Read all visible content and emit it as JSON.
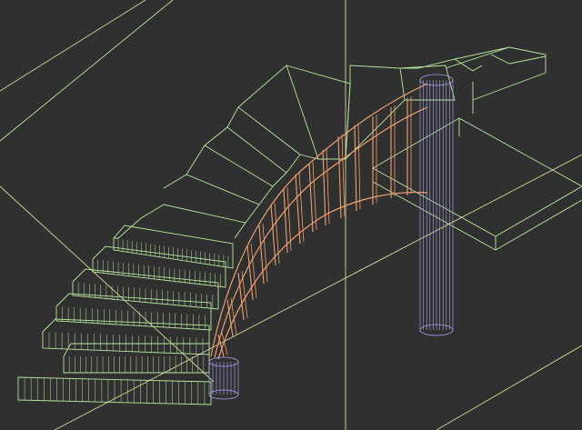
{
  "viewport": {
    "view": "3d-perspective-wireframe",
    "background": "#303030"
  },
  "scene": {
    "objects": [
      {
        "name": "curved-staircase",
        "kind": "stair-treads",
        "color": "#b8e6a0"
      },
      {
        "name": "stair-railing",
        "kind": "handrail-balusters",
        "color": "#f0a070"
      },
      {
        "name": "newel-post",
        "kind": "cylinder",
        "color": "#a9a6f0"
      },
      {
        "name": "support-column",
        "kind": "cylinder",
        "color": "#a9a6f0"
      },
      {
        "name": "upper-floor-slab",
        "kind": "slab",
        "color": "#b8e6a0"
      }
    ],
    "grid_color": "#d8d49a"
  }
}
